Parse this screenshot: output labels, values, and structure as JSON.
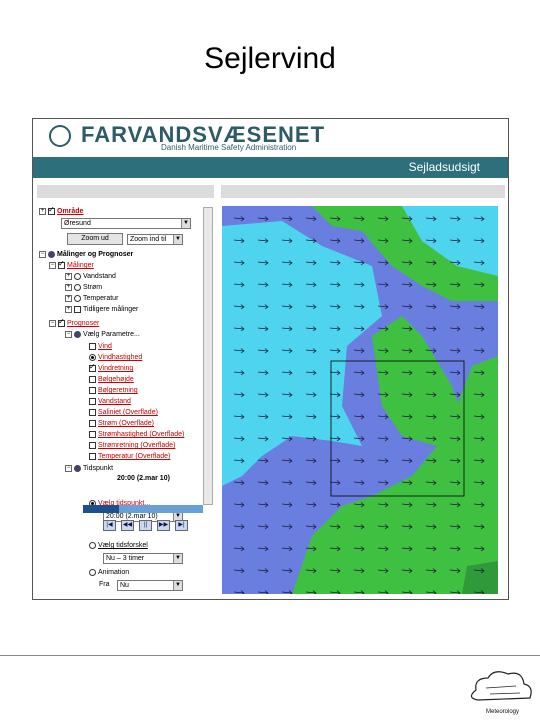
{
  "slide": {
    "title": "Sejlervind"
  },
  "header": {
    "brand": "FARVANDSVÆSENET",
    "subtitle": "Danish Maritime Safety Administration",
    "section": "Sejladsudsigt"
  },
  "panel": {
    "omrade_label": "Område",
    "omrade_value": "Øresund",
    "zoom_button": "Zoom ud",
    "zoom_select": "Zoom ind til",
    "maalinger_group": "Målinger og Prognoser",
    "maalinger_label": "Målinger",
    "maalinger_items": [
      "Vandstand",
      "Strøm",
      "Temperatur",
      "Tidligere målinger"
    ],
    "prognoser_label": "Prognoser",
    "parameter_label": "Vælg Parametre...",
    "params": [
      "Vind",
      "Vindhastighed",
      "Vindretning",
      "Bølgehøjde",
      "Bølgeretning",
      "Vandstand",
      "Saliniet (Overflade)",
      "Strøm (Overflade)",
      "Strømhastighed (Overflade)",
      "Strømretning (Overflade)",
      "Temperatur (Overflade)"
    ],
    "tidspunkt_label": "Tidspunkt",
    "tidspunkt_value": "20:00 (2.mar 10)",
    "vaelg_tidspunkt": "Vælg tidspunkt...",
    "tidspunkt_select": "20:00 (2.mar 10)",
    "vaelg_tidsforskel": "Vælg tidsforskel",
    "tidsforskel_select": "Nu – 3 timer",
    "animation_label": "Animation",
    "fra_label": "Fra",
    "fra_value": "Nu"
  },
  "colors": {
    "teal": "#2d6f7a",
    "land": "#40c040",
    "sea_light": "#4fd4f0",
    "sea_deep": "#6a7ee0"
  },
  "logo": {
    "caption": "Meteorology"
  }
}
